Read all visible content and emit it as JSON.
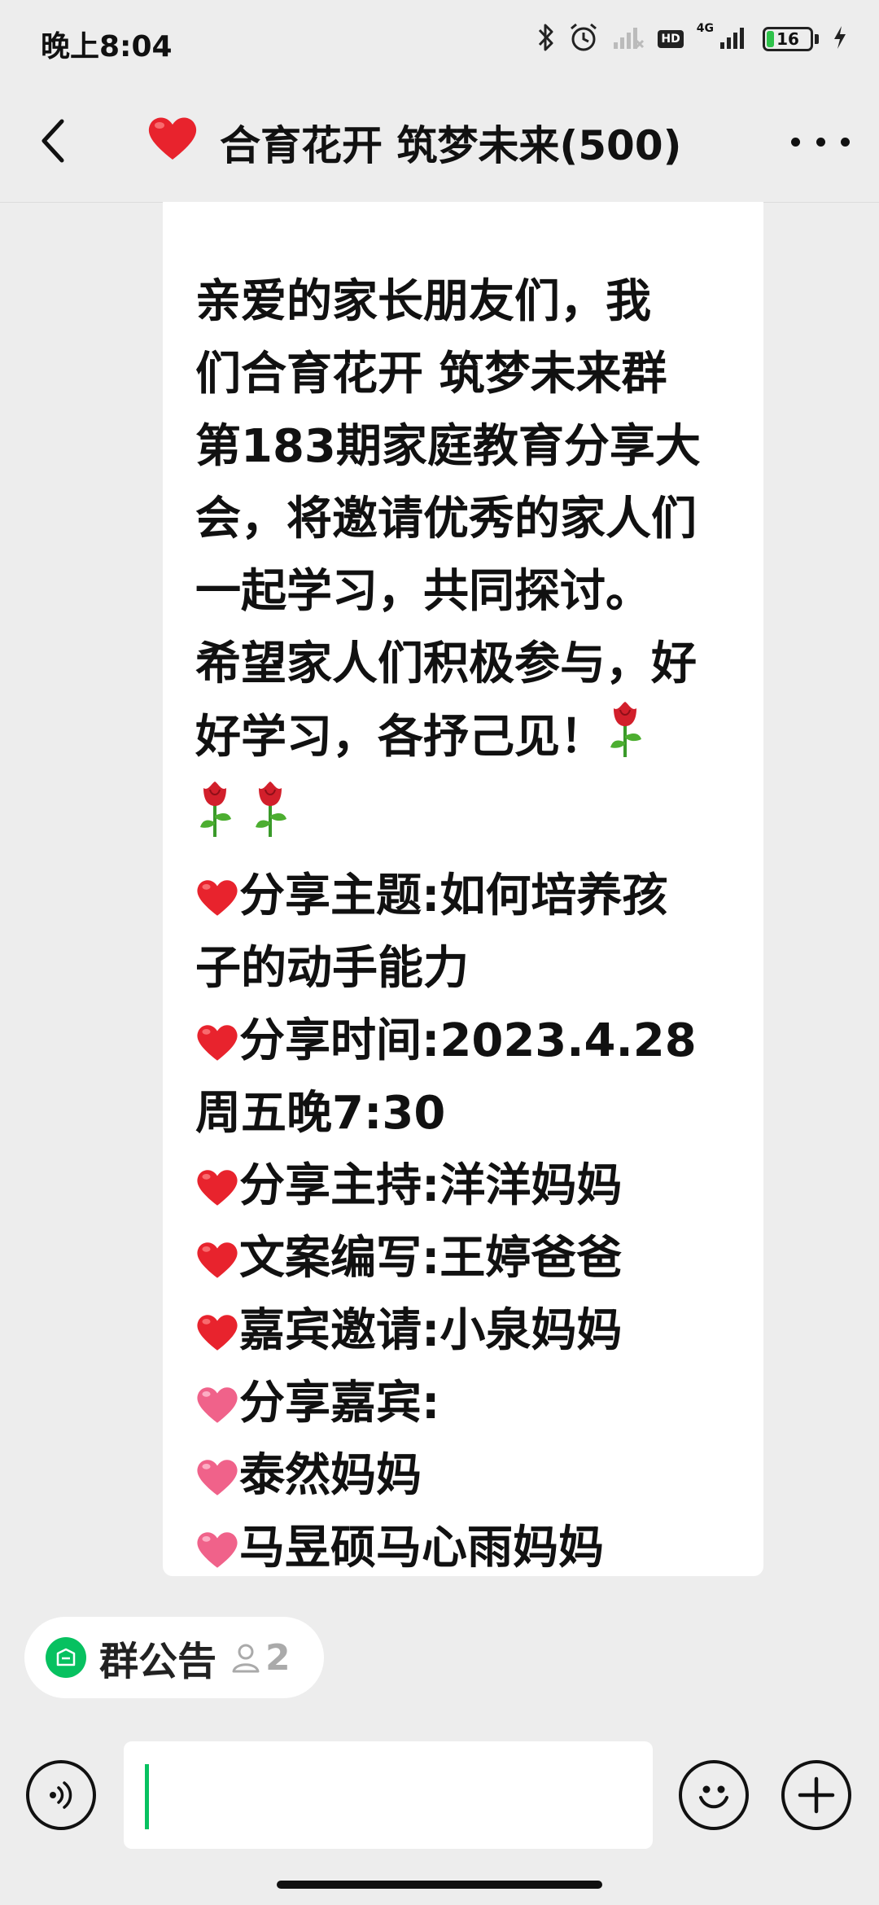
{
  "status_bar": {
    "time": "晚上8:04",
    "network_label": "4G",
    "hd_label": "HD",
    "battery_level": "16",
    "battery_fraction": 0.16,
    "icons": [
      "bluetooth-icon",
      "alarm-icon",
      "signal-weak-icon",
      "hd-icon",
      "signal-4g-icon",
      "battery-icon",
      "charging-icon"
    ]
  },
  "header": {
    "title": "合育花开 筑梦未来(500)",
    "title_emoji": "heart-emoji",
    "back_icon": "chevron-left-icon",
    "more_icon": "more-dots-icon"
  },
  "message": {
    "lines": [
      "亲爱的家长朋友们，我",
      "们合育花开 筑梦未来群",
      "第183期家庭教育分享大",
      "会，将邀请优秀的家人们",
      "一起学习，共同探讨。",
      "希望家人们积极参与，好",
      "好学习，各抒己见！",
      "",
      "分享主题:如何培养孩",
      "子的动手能力",
      "分享时间:2023.4.28",
      "周五晚7:30",
      "分享主持:洋洋妈妈",
      "文案编写:王婷爸爸",
      "嘉宾邀请:小泉妈妈",
      "分享嘉宾:",
      "泰然妈妈",
      "马昱硕马心雨妈妈"
    ]
  },
  "group_notice": {
    "label": "群公告",
    "count": "2"
  },
  "input_bar": {
    "value": "",
    "voice_icon": "voice-icon",
    "emoji_icon": "emoji-icon",
    "plus_icon": "plus-icon"
  },
  "colors": {
    "background": "#ededed",
    "bubble": "#ffffff",
    "accent": "#07c160",
    "heart_red": "#e8232d",
    "heart_pink": "#f0628a"
  }
}
